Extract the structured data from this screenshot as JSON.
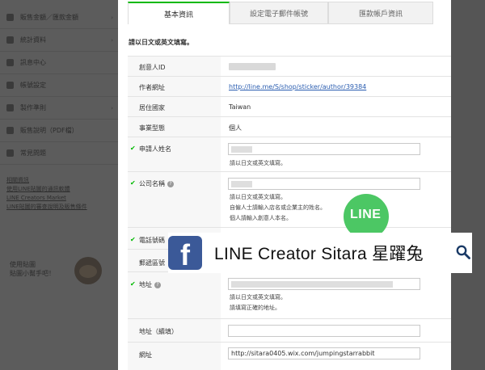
{
  "sidebar": {
    "items": [
      {
        "label": "販售金額／匯款金額",
        "icon": "wallet-icon"
      },
      {
        "label": "統計資料",
        "icon": "chart-icon"
      },
      {
        "label": "訊息中心",
        "icon": "mail-icon"
      },
      {
        "label": "帳號設定",
        "icon": "user-icon"
      },
      {
        "label": "製作準則",
        "icon": "book-icon"
      },
      {
        "label": "販售說明（PDF檔）",
        "icon": "document-icon"
      },
      {
        "label": "常見問題",
        "icon": "question-icon"
      }
    ],
    "links_heading": "相關資訊",
    "links": [
      "使用LINE貼圖的通訊軟體",
      "LINE Creators Market",
      "LINE貼圖的審查說明及販售條件"
    ],
    "promo": [
      "使用貼圖",
      "貼圖小幫手吧！"
    ]
  },
  "tabs": [
    {
      "label": "基本資訊",
      "active": true
    },
    {
      "label": "設定電子郵件帳號",
      "active": false
    },
    {
      "label": "匯款帳戶資訊",
      "active": false
    }
  ],
  "instruction": "請以日文或英文填寫。",
  "rows": {
    "creator_id": {
      "label": "創意人ID"
    },
    "author_url": {
      "label": "作者網址",
      "value": "http://line.me/S/shop/sticker/author/39384"
    },
    "country": {
      "label": "居住國家",
      "value": "Taiwan"
    },
    "business_type": {
      "label": "事業型態",
      "value": "個人"
    },
    "applicant_name": {
      "label": "申請人姓名",
      "help": "請以日文或英文填寫。"
    },
    "company_name": {
      "label": "公司名稱",
      "help_lines": [
        "請以日文或英文填寫。",
        "自僱人士請輸入店名或企業主的姓名。",
        "個人請輸入創意人本名。"
      ]
    },
    "phone": {
      "label": "電話號碼"
    },
    "postal_code": {
      "label": "郵遞區號"
    },
    "address": {
      "label": "地址",
      "help_lines": [
        "請以日文或英文填寫。",
        "請填寫正確的地址。"
      ]
    },
    "address_cont": {
      "label": "地址（續填）"
    },
    "website": {
      "label": "網址",
      "value": "http://sitara0405.wix.com/jumpingstarrabbit"
    }
  },
  "banner": {
    "text": "LINE Creator   Sitara   星躍兔",
    "fb_letter": "f",
    "line_logo": "LINE"
  },
  "colors": {
    "accent": "#00b900",
    "link": "#2a5db0",
    "facebook": "#3b5998",
    "line_green": "#4cc764"
  }
}
